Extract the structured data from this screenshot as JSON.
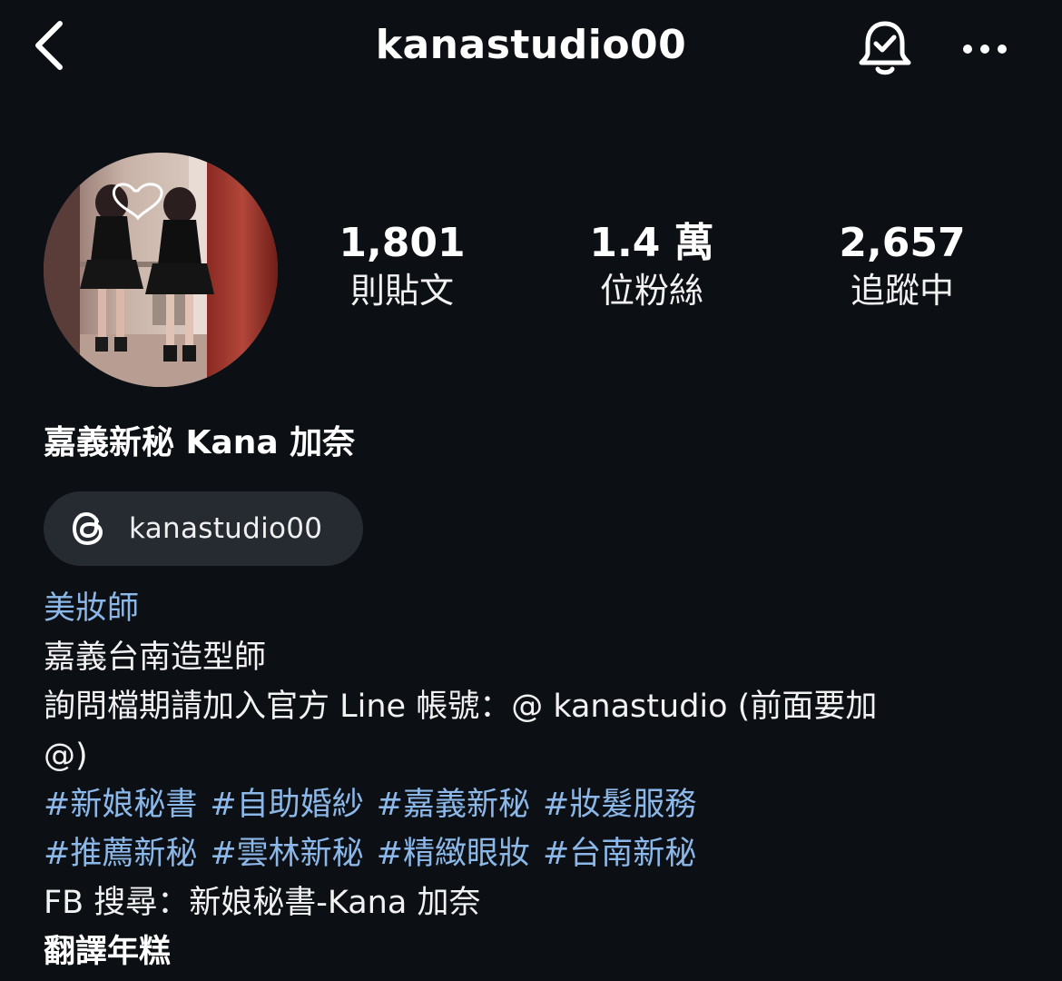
{
  "header": {
    "title": "kanastudio00",
    "back_icon": "chevron-left-icon",
    "bell_icon": "bell-check-icon",
    "more_icon": "more-horizontal-icon"
  },
  "profile": {
    "avatar_description_icon": "avatar-photo",
    "stats": {
      "posts_value": "1,801",
      "posts_label": "則貼文",
      "followers_value": "1.4 萬",
      "followers_label": "位粉絲",
      "following_value": "2,657",
      "following_label": "追蹤中"
    },
    "display_name": "嘉義新秘 Kana 加奈",
    "threads": {
      "icon": "threads-icon",
      "handle": "kanastudio00"
    }
  },
  "bio": {
    "category": "美妝師",
    "line1": "嘉義台南造型師",
    "line2": "詢問檔期請加入官方 Line 帳號：@ kanastudio (前面要加",
    "line3": "@)",
    "hashtags_row1": [
      "#新娘秘書",
      "#自助婚紗",
      "#嘉義新秘",
      "#妝髮服務"
    ],
    "hashtags_row2": [
      "#推薦新秘",
      "#雲林新秘",
      "#精緻眼妝",
      "#台南新秘"
    ],
    "fb_line": "FB 搜尋：新娘秘書-Kana 加奈",
    "translate": "翻譯年糕"
  },
  "colors": {
    "background": "#0c0f14",
    "link": "#8bb8e8",
    "badge_bg": "#262a31"
  }
}
